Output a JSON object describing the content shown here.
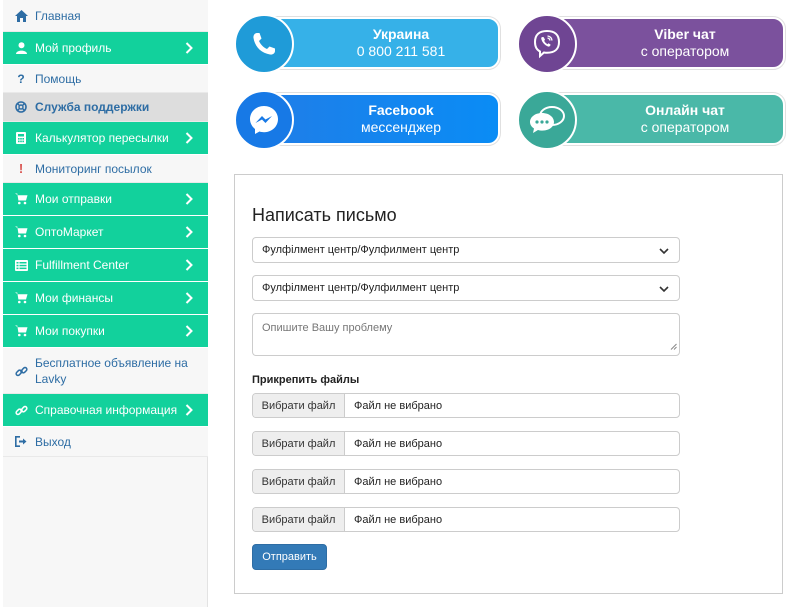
{
  "sidebar": {
    "items": [
      {
        "label": "Главная",
        "icon": "home-icon"
      },
      {
        "label": "Мой профиль",
        "icon": "user-icon"
      },
      {
        "label": "Помощь",
        "icon": "question-icon"
      },
      {
        "label": "Служба поддержки",
        "icon": "lifebuoy-icon"
      },
      {
        "label": "Калькулятор пересылки",
        "icon": "calculator-icon"
      },
      {
        "label": "Мониторинг посылок",
        "icon": "exclamation-icon"
      },
      {
        "label": "Мои отправки",
        "icon": "cart-icon"
      },
      {
        "label": "ОптоМаркет",
        "icon": "cart-icon"
      },
      {
        "label": "Fulfillment Center",
        "icon": "list-icon"
      },
      {
        "label": "Мои финансы",
        "icon": "cart-icon"
      },
      {
        "label": "Мои покупки",
        "icon": "cart-icon"
      },
      {
        "label": "Бесплатное объявление на Lavky",
        "icon": "link-icon"
      },
      {
        "label": "Справочная информация",
        "icon": "link-icon"
      },
      {
        "label": "Выход",
        "icon": "logout-icon"
      }
    ]
  },
  "contacts": {
    "phone": {
      "line1": "Украина",
      "line2": "0 800 211 581",
      "color": "#36b1e8"
    },
    "viber": {
      "line1": "Viber чат",
      "line2": "с оператором",
      "color": "#7b519d"
    },
    "facebook": {
      "line1": "Facebook",
      "line2": "мессенджер",
      "color": "#1f7ee8"
    },
    "online": {
      "line1": "Онлайн чат",
      "line2": "с оператором",
      "color": "#4ab8a8"
    }
  },
  "form": {
    "title": "Написать письмо",
    "select1": "Фулфілмент центр/Фулфилмент центр",
    "select2": "Фулфілмент центр/Фулфилмент центр",
    "placeholder": "Опишите Вашу проблему",
    "attach_label": "Прикрепить файлы",
    "files": [
      {
        "button": "Вибрати файл",
        "name": "Файл не вибрано"
      },
      {
        "button": "Вибрати файл",
        "name": "Файл не вибрано"
      },
      {
        "button": "Вибрати файл",
        "name": "Файл не вибрано"
      },
      {
        "button": "Вибрати файл",
        "name": "Файл не вибрано"
      }
    ],
    "submit": "Отправить"
  },
  "colors": {
    "accent_green": "#12d19c",
    "link_blue": "#2e6da4",
    "primary_button": "#337ab7"
  }
}
